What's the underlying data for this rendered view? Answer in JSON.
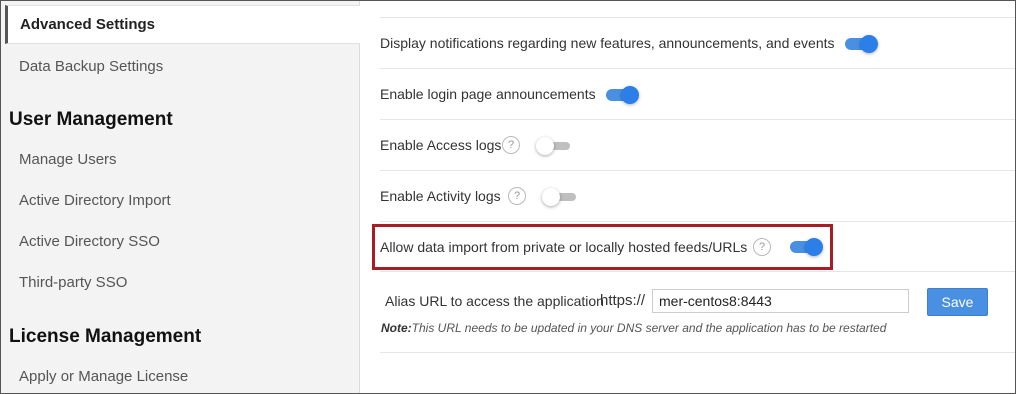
{
  "sidebar": {
    "active_item": "Advanced Settings",
    "items_top": [
      "Data Backup Settings"
    ],
    "user_management": {
      "heading": "User Management",
      "items": [
        "Manage Users",
        "Active Directory Import",
        "Active Directory SSO",
        "Third-party SSO"
      ]
    },
    "license_management": {
      "heading": "License Management",
      "items": [
        "Apply or Manage License"
      ]
    }
  },
  "settings": [
    {
      "label": "Display notifications regarding new features, announcements, and events",
      "enabled": true,
      "help": false
    },
    {
      "label": "Enable login page announcements",
      "enabled": true,
      "help": false
    },
    {
      "label": "Enable Access logs",
      "enabled": false,
      "help": true
    },
    {
      "label": "Enable Activity logs",
      "enabled": false,
      "help": true
    },
    {
      "label": "Allow data import from private or locally hosted feeds/URLs",
      "enabled": true,
      "help": true
    }
  ],
  "help_glyph": "?",
  "alias": {
    "label": "Alias URL to access the application",
    "prefix": "https://",
    "value": "mer-centos8:8443",
    "save_label": "Save",
    "note_prefix": "Note:",
    "note_text": "This URL needs to be updated in your DNS server and the application has to be restarted"
  },
  "colors": {
    "accent": "#4a90e2",
    "highlight_border": "#a81d23",
    "toggle_off": "#bfbfbf"
  }
}
